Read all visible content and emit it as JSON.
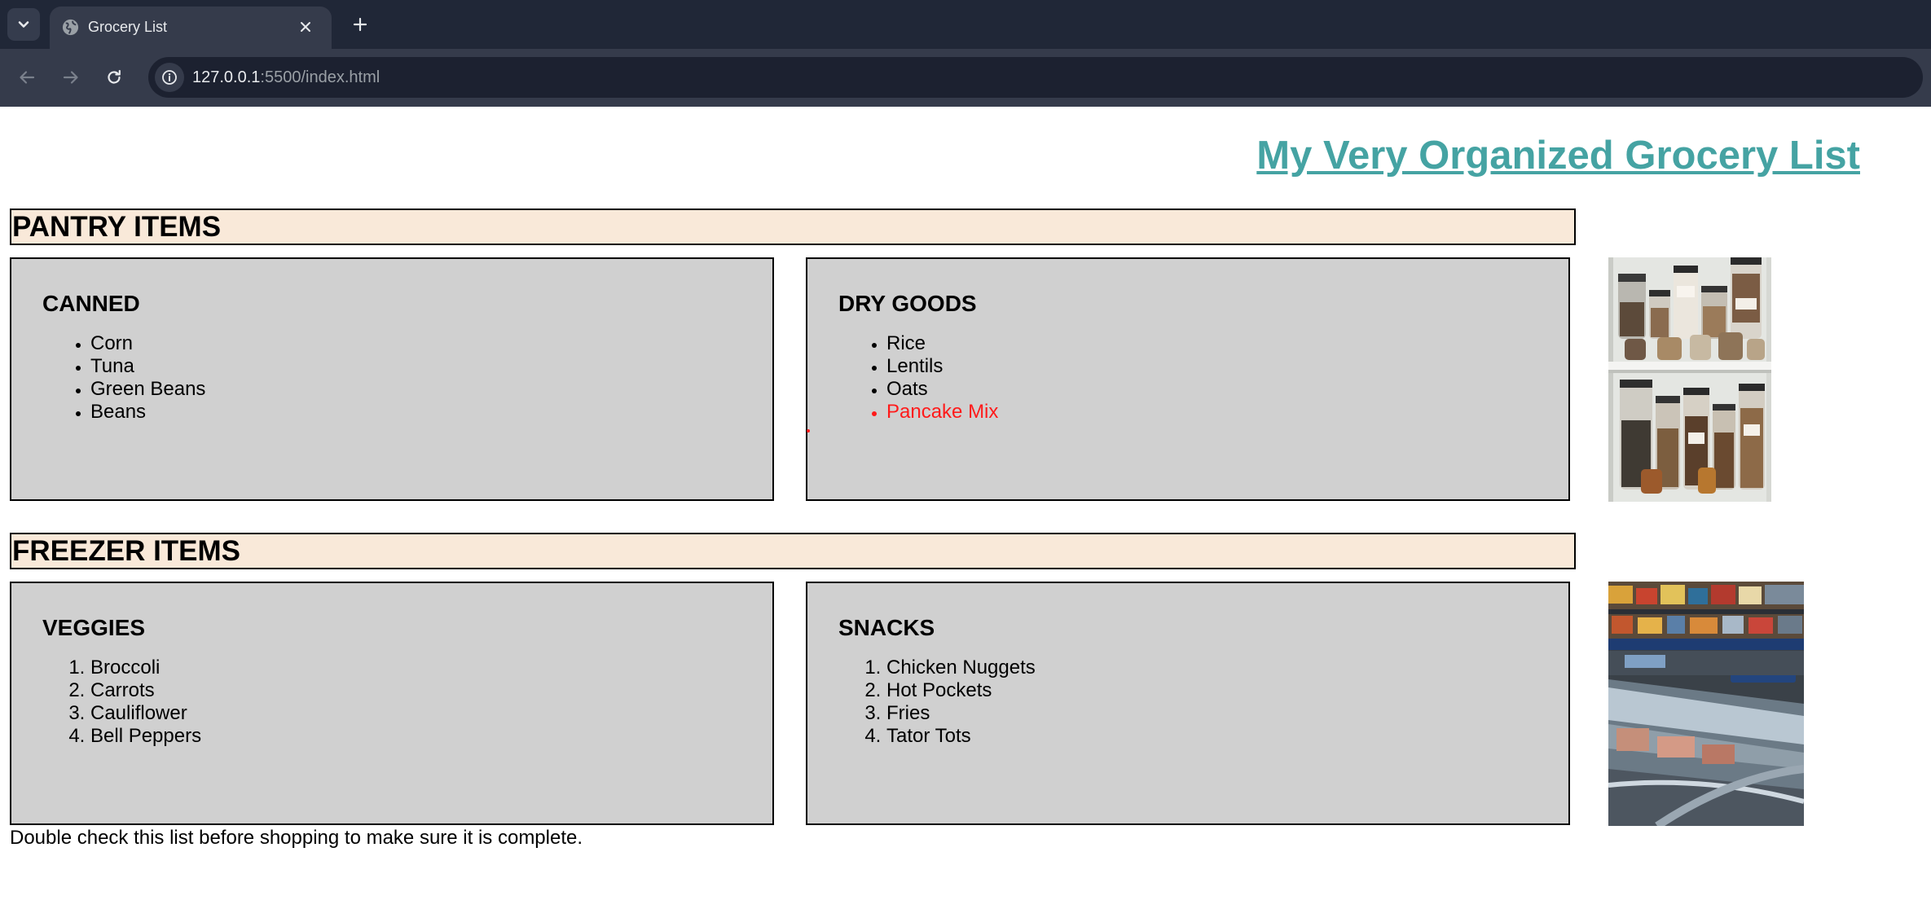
{
  "browser": {
    "tab_title": "Grocery List",
    "url_host": "127.0.0.1",
    "url_rest": ":5500/index.html",
    "icons": {
      "tab_search": "chevron-down-icon",
      "favicon": "globe-icon",
      "close": "close-icon",
      "new_tab": "plus-icon",
      "back": "arrow-left-icon",
      "forward": "arrow-right-icon",
      "reload": "reload-icon",
      "site_info": "info-icon"
    }
  },
  "page": {
    "title": "My Very Organized Grocery List",
    "title_color": "#45a3a3",
    "header_bg": "#f9e9d9",
    "box_bg": "#d0d0d0",
    "sections": {
      "pantry": {
        "title": "PANTRY ITEMS",
        "canned": {
          "heading": "CANNED",
          "items": [
            "Corn",
            "Tuna",
            "Green Beans",
            "Beans"
          ]
        },
        "dry_goods": {
          "heading": "DRY GOODS",
          "items": [
            "Rice",
            "Lentils",
            "Oats",
            "Pancake Mix"
          ],
          "highlight_color": "#ff1a1a"
        }
      },
      "freezer": {
        "title": "FREEZER ITEMS",
        "veggies": {
          "heading": "VEGGIES",
          "items": [
            "Broccoli",
            "Carrots",
            "Cauliflower",
            "Bell Peppers"
          ]
        },
        "snacks": {
          "heading": "SNACKS",
          "items": [
            "Chicken Nuggets",
            "Hot Pockets",
            "Fries",
            "Tator Tots"
          ]
        }
      }
    },
    "footer_note": "Double check this list before shopping to make sure it is complete."
  }
}
